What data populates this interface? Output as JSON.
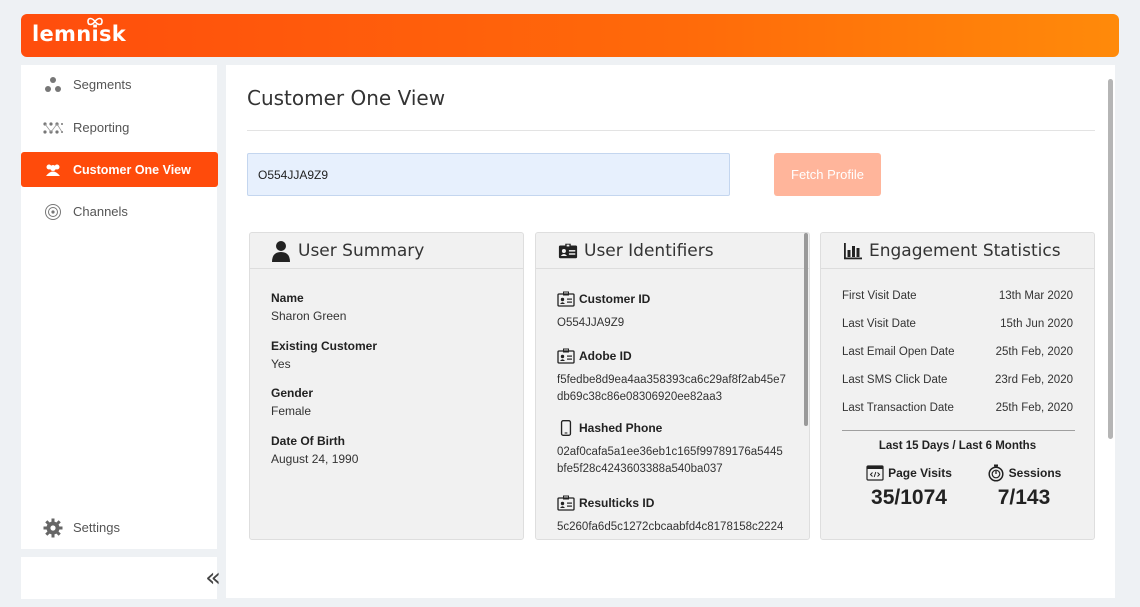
{
  "brand": {
    "name": "lemnisk",
    "accent": "#ff4b0b"
  },
  "sidebar": {
    "items": [
      {
        "label": "Segments",
        "icon": "segments-icon"
      },
      {
        "label": "Reporting",
        "icon": "reporting-icon"
      },
      {
        "label": "Customer One View",
        "icon": "customer-icon",
        "active": true
      },
      {
        "label": "Channels",
        "icon": "channels-icon"
      }
    ],
    "settings_label": "Settings",
    "collapse_glyph": "«"
  },
  "main": {
    "title": "Customer One View",
    "search": {
      "value": "O554JJA9Z9"
    },
    "fetch_label": "Fetch Profile"
  },
  "user_summary": {
    "title": "User Summary",
    "fields": [
      {
        "label": "Name",
        "value": "Sharon Green"
      },
      {
        "label": "Existing Customer",
        "value": "Yes"
      },
      {
        "label": "Gender",
        "value": "Female"
      },
      {
        "label": "Date Of Birth",
        "value": "August 24, 1990"
      }
    ]
  },
  "user_identifiers": {
    "title": "User Identifiers",
    "items": [
      {
        "label": "Customer ID",
        "value": "O554JJA9Z9",
        "icon": "id-card-icon"
      },
      {
        "label": "Adobe ID",
        "value": "f5fedbe8d9ea4aa358393ca6c29af8f2ab45e7db69c38c86e08306920ee82aa3",
        "icon": "id-card-icon"
      },
      {
        "label": "Hashed Phone",
        "value": "02af0cafa5a1ee36eb1c165f99789176a5445bfe5f28c4243603388a540ba037",
        "icon": "phone-icon"
      },
      {
        "label": "Resulticks ID",
        "value": "5c260fa6d5c1272cbcaabfd4c8178158c2224",
        "icon": "id-card-icon"
      }
    ]
  },
  "engagement": {
    "title": "Engagement Statistics",
    "rows": [
      {
        "label": "First Visit Date",
        "value": "13th Mar 2020"
      },
      {
        "label": "Last Visit Date",
        "value": "15th Jun 2020"
      },
      {
        "label": "Last Email Open Date",
        "value": "25th Feb, 2020"
      },
      {
        "label": "Last SMS Click Date",
        "value": "23rd Feb, 2020"
      },
      {
        "label": "Last Transaction Date",
        "value": "25th Feb, 2020"
      }
    ],
    "period_label": "Last 15 Days / Last 6 Months",
    "page_visits": {
      "label": "Page Visits",
      "value": "35/1074"
    },
    "sessions": {
      "label": "Sessions",
      "value": "7/143"
    }
  }
}
